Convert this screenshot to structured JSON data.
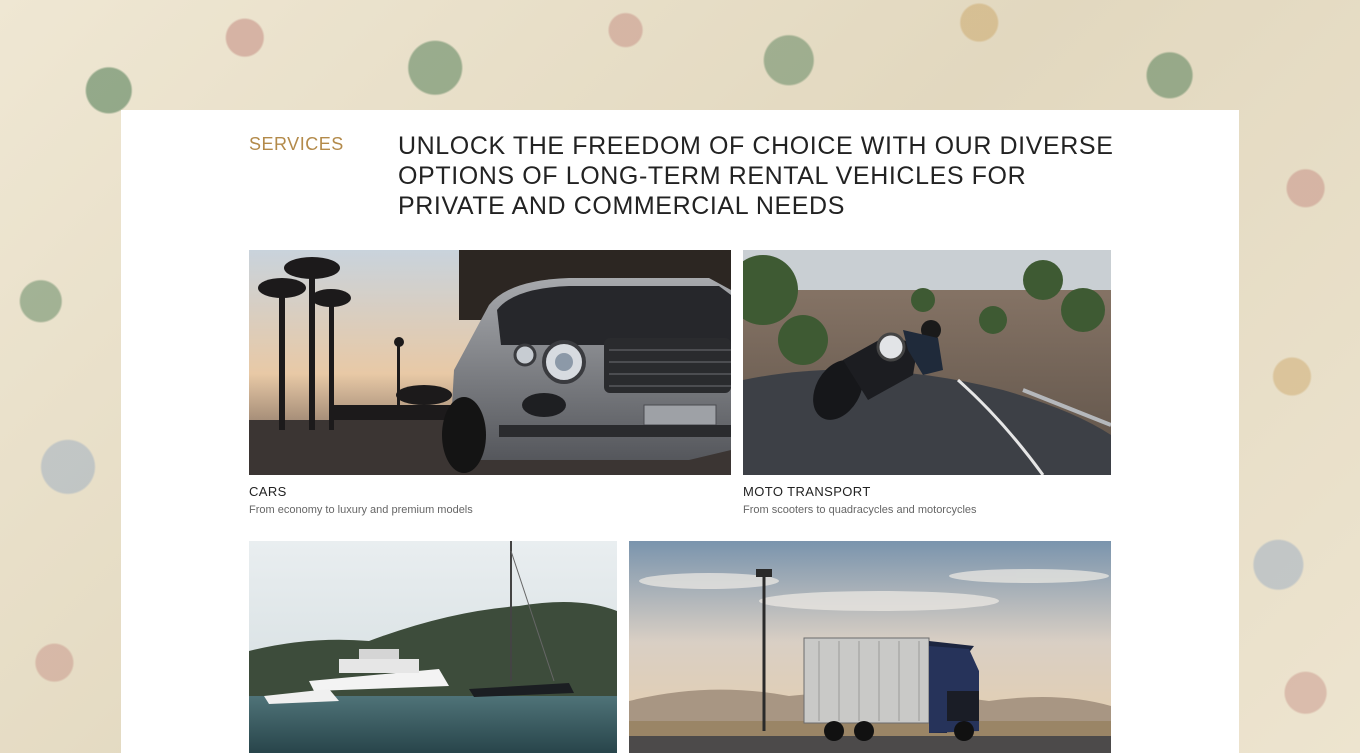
{
  "section": {
    "label": "SERVICES",
    "headline": "UNLOCK THE FREEDOM OF CHOICE  WITH OUR DIVERSE OPTIONS OF LONG-TERM RENTAL VEHICLES FOR PRIVATE AND COMMERCIAL NEEDS"
  },
  "services": [
    {
      "title": "CARS",
      "subtitle": "From economy to luxury and premium models"
    },
    {
      "title": "MOTO TRANSPORT",
      "subtitle": "From scooters to quadracycles and motorcycles"
    },
    {
      "title": "",
      "subtitle": ""
    },
    {
      "title": "",
      "subtitle": ""
    }
  ],
  "colors": {
    "accent": "#b38a4a",
    "heading": "#222222",
    "card_bg": "#ffffff"
  }
}
